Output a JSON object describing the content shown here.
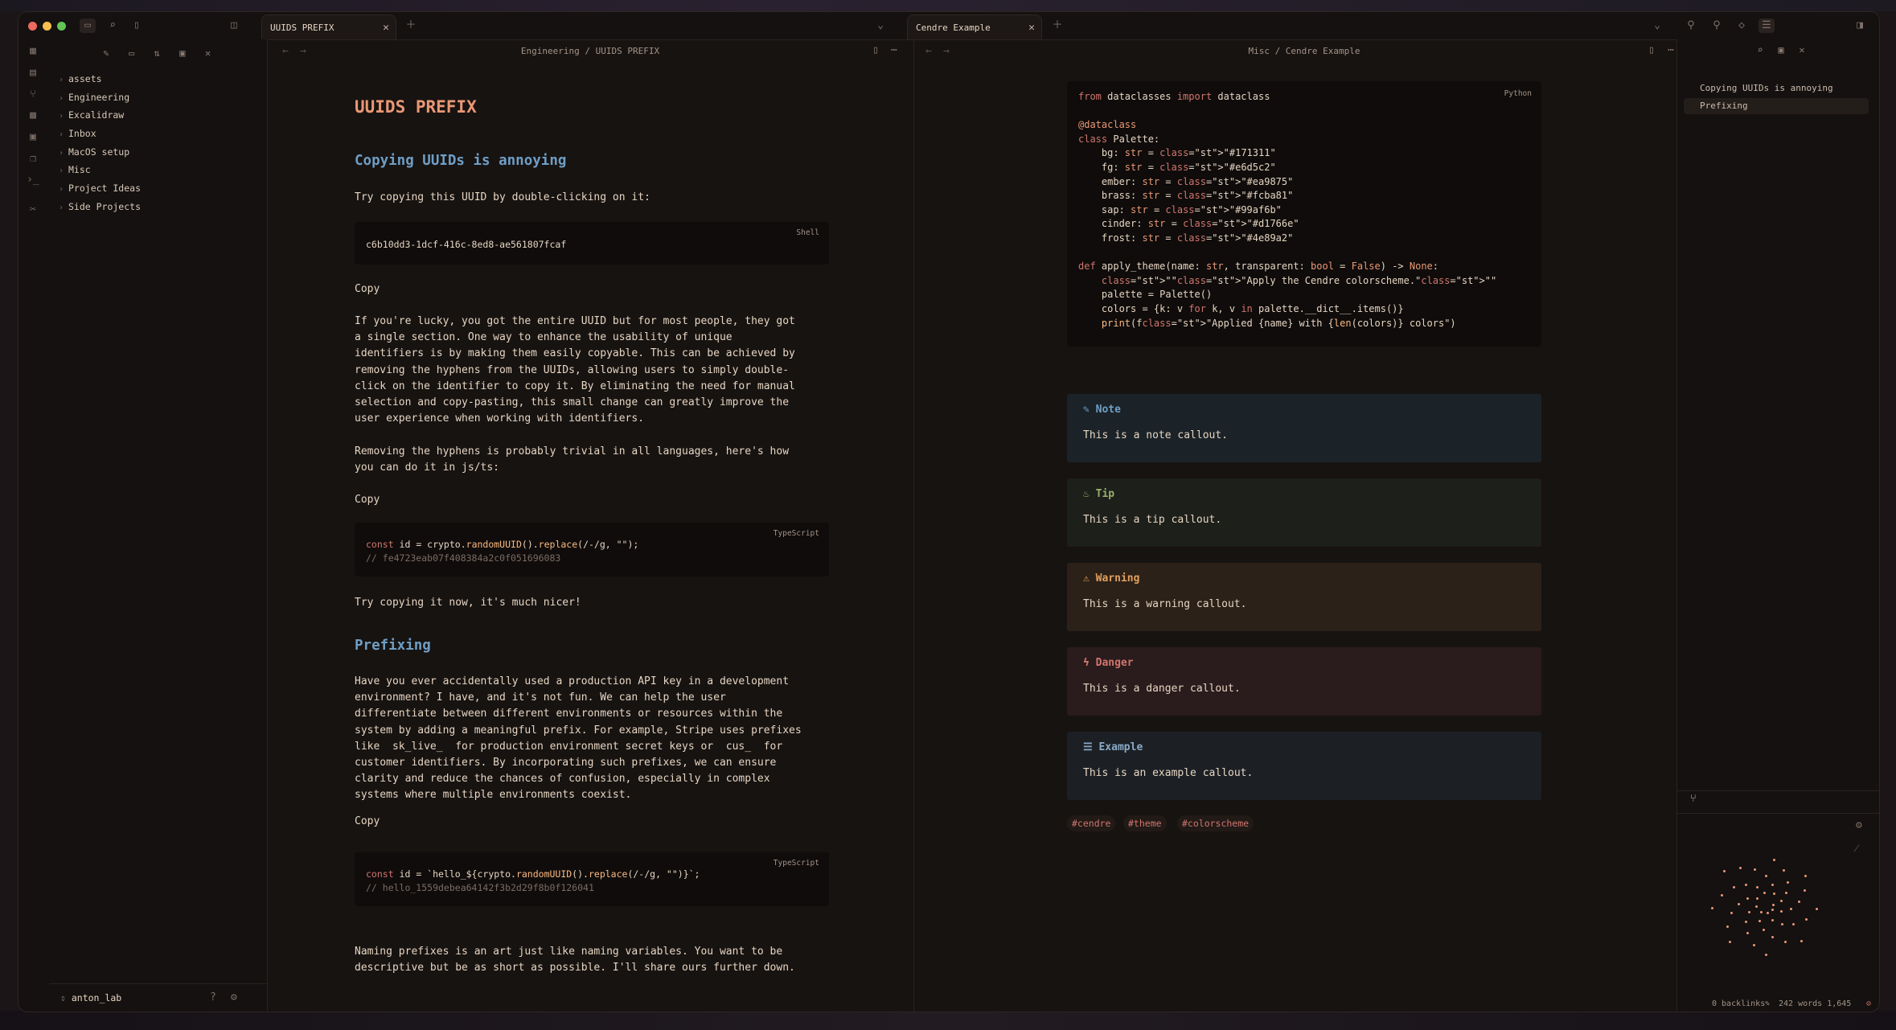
{
  "colors": {
    "bg": "#171311",
    "fg": "#e6d5c2",
    "ember": "#ea9875",
    "brass": "#fcba81",
    "sap": "#99af6b",
    "cinder": "#d1766e",
    "frost": "#4e89a2"
  },
  "tabs": {
    "left": {
      "title": "UUIDS PREFIX"
    },
    "right": {
      "title": "Cendre Example"
    }
  },
  "sidebar": {
    "items": [
      {
        "label": "assets"
      },
      {
        "label": "Engineering"
      },
      {
        "label": "Excalidraw"
      },
      {
        "label": "Inbox"
      },
      {
        "label": "MacOS setup"
      },
      {
        "label": "Misc"
      },
      {
        "label": "Project Ideas"
      },
      {
        "label": "Side Projects"
      }
    ],
    "vault": "anton_lab"
  },
  "left_pane": {
    "breadcrumb": "Engineering / UUIDS PREFIX",
    "title": "UUIDS PREFIX",
    "h2_1": "Copying UUIDs is annoying",
    "p1": "Try copying this UUID by double-clicking on it:",
    "code1": {
      "lang": "Shell",
      "text": "c6b10dd3-1dcf-416c-8ed8-ae561807fcaf"
    },
    "copy1": "Copy",
    "p2": "If you're lucky, you got the entire UUID but for most people, they got\na single section. One way to enhance the usability of unique\nidentifiers is by making them easily copyable. This can be achieved by\nremoving the hyphens from the UUIDs, allowing users to simply double-\nclick on the identifier to copy it. By eliminating the need for manual\nselection and copy-pasting, this small change can greatly improve the\nuser experience when working with identifiers.",
    "p3": "Removing the hyphens is probably trivial in all languages, here's how\nyou can do it in js/ts:",
    "copy2": "Copy",
    "code2": {
      "lang": "TypeScript",
      "l1a": "const",
      "l1b": " id = crypto.",
      "l1c": "randomUUID",
      "l1d": "().",
      "l1e": "replace",
      "l1f": "(/-/g, \"\");",
      "l2": "// fe4723eab07f408384a2c0f051696083"
    },
    "p4": "Try copying it now, it's much nicer!",
    "h2_2": "Prefixing",
    "p5": "Have you ever accidentally used a production API key in a development\nenvironment? I have, and it's not fun. We can help the user\ndifferentiate between different environments or resources within the\nsystem by adding a meaningful prefix. For example, Stripe uses prefixes\nlike  sk_live_  for production environment secret keys or  cus_  for\ncustomer identifiers. By incorporating such prefixes, we can ensure\nclarity and reduce the chances of confusion, especially in complex\nsystems where multiple environments coexist.",
    "copy3": "Copy",
    "code3": {
      "lang": "TypeScript",
      "l1a": "const",
      "l1b": " id = `hello_${crypto.",
      "l1c": "randomUUID",
      "l1d": "().",
      "l1e": "replace",
      "l1f": "(/-/g, \"\")}`;",
      "l2": "// hello_1559debea64142f3b2d29f8b0f126041"
    },
    "p6": "Naming prefixes is an art just like naming variables. You want to be\ndescriptive but be as short as possible. I'll share ours further down."
  },
  "right_pane": {
    "breadcrumb": "Misc / Cendre Example",
    "code_lang": "Python",
    "code_lines": [
      "from dataclasses import dataclass",
      "",
      "@dataclass",
      "class Palette:",
      "    bg: str = \"#171311\"",
      "    fg: str = \"#e6d5c2\"",
      "    ember: str = \"#ea9875\"",
      "    brass: str = \"#fcba81\"",
      "    sap: str = \"#99af6b\"",
      "    cinder: str = \"#d1766e\"",
      "    frost: str = \"#4e89a2\"",
      "",
      "def apply_theme(name: str, transparent: bool = False) -> None:",
      "    \"\"\"Apply the Cendre colorscheme.\"\"\"",
      "    palette = Palette()",
      "    colors = {k: v for k, v in palette.__dict__.items()}",
      "    print(f\"Applied {name} with {len(colors)} colors\")"
    ],
    "callouts": [
      {
        "title": "Note",
        "body": "This is a note callout.",
        "color": "#6f9ec5",
        "bg": "#1b2328"
      },
      {
        "title": "Tip",
        "body": "This is a tip callout.",
        "color": "#99af6b",
        "bg": "#1d1f1a"
      },
      {
        "title": "Warning",
        "body": "This is a warning callout.",
        "color": "#e2a05f",
        "bg": "#2b2118"
      },
      {
        "title": "Danger",
        "body": "This is a danger callout.",
        "color": "#d1766e",
        "bg": "#2a1b1d"
      },
      {
        "title": "Example",
        "body": "This is an example callout.",
        "color": "#8aa9c6",
        "bg": "#1c2025"
      }
    ],
    "tags": [
      "#cendre",
      "#theme",
      "#colorscheme"
    ]
  },
  "outline": {
    "items": [
      {
        "label": "Copying UUIDs is annoying"
      },
      {
        "label": "Prefixing"
      }
    ]
  },
  "status": {
    "backlinks": "0 backlinks",
    "counts": "242 words 1,645 characters"
  }
}
